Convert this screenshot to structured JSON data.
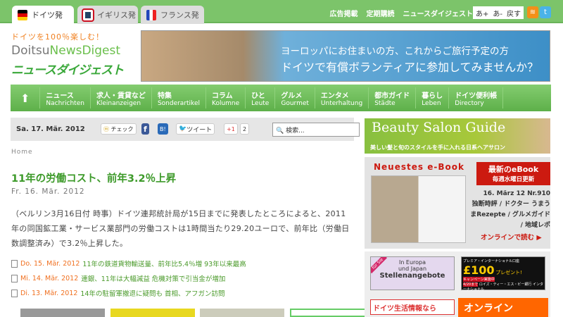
{
  "tabs": [
    {
      "label": "ドイツ発",
      "active": true
    },
    {
      "label": "イギリス発"
    },
    {
      "label": "フランス発"
    }
  ],
  "top_links": [
    "広告掲載",
    "定期購読",
    "ニュースダイジェストとは？"
  ],
  "font_buttons": [
    "あ+",
    "あ-",
    "戻す"
  ],
  "logo": {
    "tagline": "ドイツを100％楽しむ！",
    "en_a": "Doitsu",
    "en_b": "NewsDigest",
    "jp": "ニュースダイジェスト"
  },
  "banner": {
    "line1": "ヨーロッパにお住まいの方、これからご旅行予定の方",
    "line2": "ドイツで有償ボランティアに参加してみませんか？"
  },
  "nav": [
    {
      "jp": "ニュース",
      "de": "Nachrichten"
    },
    {
      "jp": "求人・賃貸など",
      "de": "Kleinanzeigen"
    },
    {
      "jp": "特集",
      "de": "Sonderartikel"
    },
    {
      "jp": "コラム",
      "de": "Kolumne"
    },
    {
      "jp": "ひと",
      "de": "Leute"
    },
    {
      "jp": "グルメ",
      "de": "Gourmet"
    },
    {
      "jp": "エンタメ",
      "de": "Unterhaltung"
    },
    {
      "jp": "都市ガイド",
      "de": "Städte"
    },
    {
      "jp": "暮らし",
      "de": "Leben"
    },
    {
      "jp": "ドイツ便利帳",
      "de": "Directory"
    }
  ],
  "toolbar": {
    "date": "Sa. 17. Mär. 2012",
    "check": "チェック",
    "tweet": "ツイート",
    "gplus": "+1",
    "gplus_count": "2",
    "search_placeholder": "検索..."
  },
  "breadcrumb": "Home",
  "article": {
    "title": "11年の労働コスト、前年3.2％上昇",
    "date": "Fr. 16. Mär. 2012",
    "body": "（ベルリン3月16日付 時事）ドイツ連邦統計局が15日までに発表したところによると、2011年の同国鉱工業・サービス業部門の労働コストは1時間当たり29.20ユーロで、前年比（労働日数調整済み）で3.2％上昇した。"
  },
  "related": [
    {
      "date": "Do. 15. Mär. 2012",
      "title": "11年の鉄道貨物輸送量、前年比5.4％増 93年以来最高"
    },
    {
      "date": "Mi. 14. Mär. 2012",
      "title": "連銀、11年は大幅減益 危機対策で引当金が増加"
    },
    {
      "date": "Di. 13. Mär. 2012",
      "title": "14年の駐留軍撤退に疑問も 首相、アフガン訪問"
    }
  ],
  "sidebar": {
    "beauty": {
      "title": "Beauty Salon Guide",
      "subtitle": "美しい髪と旬のスタイルを手に入れる日系ヘアサロン"
    },
    "ebook": {
      "heading": "Neuestes e-Book",
      "badge1": "最新のeBook",
      "badge2": "毎週水曜日更新",
      "issue": "16. März 12 Nr.910",
      "contents": "独断時評 / ドクター うまうまRezepte / グルメガイド / 地域レポ",
      "read": "オンラインで読む"
    },
    "ad1": {
      "tag": "für Sie",
      "l1": "In Europa",
      "l2": "und Japan",
      "l3": "Stellenangebote"
    },
    "ad2": {
      "l1": "プレミア・インターナショナル口座",
      "amount": "£100",
      "l2": "プレゼント!",
      "l3": "キャンペーン実施中",
      "until": "4/20まで",
      "bank": "ロイズ・ティー・エス・ビー銀行 インターナショナル"
    },
    "ad3": "ドイツ生活情報なら",
    "ad4": "オンライン"
  },
  "colors": {
    "green": "#7cc46a",
    "title_green": "#3d9a2a",
    "orange": "#f07020",
    "red": "#cc1a10"
  }
}
